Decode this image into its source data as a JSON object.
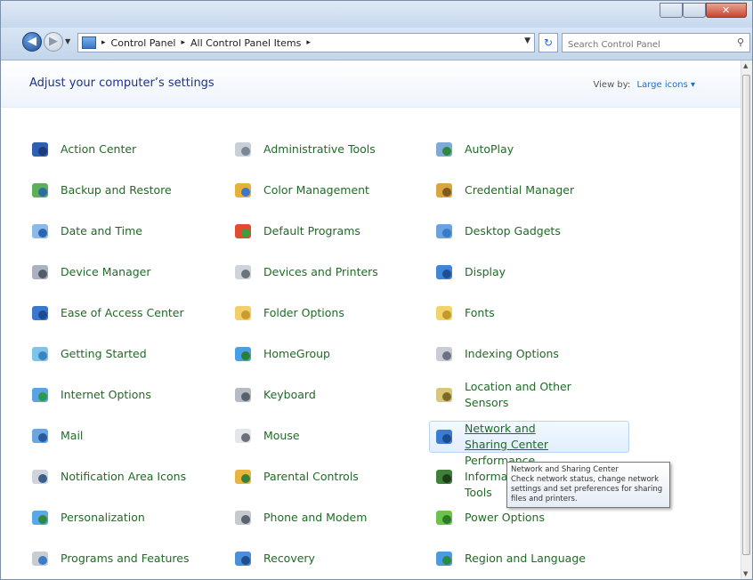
{
  "address": {
    "crumbs": [
      "Control Panel",
      "All Control Panel Items"
    ],
    "separator": "▸",
    "search_placeholder": "Search Control Panel"
  },
  "header": {
    "title": "Adjust your computer’s settings",
    "view_by_label": "View by:",
    "view_by_value": "Large icons ▾"
  },
  "items": [
    {
      "label": "Action Center",
      "icon": "flag-icon"
    },
    {
      "label": "Administrative Tools",
      "icon": "admin-tools-icon"
    },
    {
      "label": "AutoPlay",
      "icon": "autoplay-icon"
    },
    {
      "label": "Backup and Restore",
      "icon": "backup-icon"
    },
    {
      "label": "Color Management",
      "icon": "color-management-icon"
    },
    {
      "label": "Credential Manager",
      "icon": "credential-icon"
    },
    {
      "label": "Date and Time",
      "icon": "calendar-icon"
    },
    {
      "label": "Default Programs",
      "icon": "default-programs-icon"
    },
    {
      "label": "Desktop Gadgets",
      "icon": "gadgets-icon"
    },
    {
      "label": "Device Manager",
      "icon": "device-manager-icon"
    },
    {
      "label": "Devices and Printers",
      "icon": "printer-icon"
    },
    {
      "label": "Display",
      "icon": "display-icon"
    },
    {
      "label": "Ease of Access Center",
      "icon": "accessibility-icon"
    },
    {
      "label": "Folder Options",
      "icon": "folder-icon"
    },
    {
      "label": "Fonts",
      "icon": "fonts-icon"
    },
    {
      "label": "Getting Started",
      "icon": "getting-started-icon"
    },
    {
      "label": "HomeGroup",
      "icon": "homegroup-icon"
    },
    {
      "label": "Indexing Options",
      "icon": "indexing-icon"
    },
    {
      "label": "Internet Options",
      "icon": "globe-icon"
    },
    {
      "label": "Keyboard",
      "icon": "keyboard-icon"
    },
    {
      "label": "Location and Other Sensors",
      "icon": "sensors-icon"
    },
    {
      "label": "Mail",
      "icon": "mail-icon"
    },
    {
      "label": "Mouse",
      "icon": "mouse-icon"
    },
    {
      "label": "Network and Sharing Center",
      "icon": "network-icon"
    },
    {
      "label": "Notification Area Icons",
      "icon": "notification-icon"
    },
    {
      "label": "Parental Controls",
      "icon": "parental-controls-icon"
    },
    {
      "label": "Performance Information and Tools",
      "icon": "performance-icon"
    },
    {
      "label": "Personalization",
      "icon": "personalization-icon"
    },
    {
      "label": "Phone and Modem",
      "icon": "phone-icon"
    },
    {
      "label": "Power Options",
      "icon": "power-icon"
    },
    {
      "label": "Programs and Features",
      "icon": "programs-icon"
    },
    {
      "label": "Recovery",
      "icon": "recovery-icon"
    },
    {
      "label": "Region and Language",
      "icon": "region-icon"
    }
  ],
  "tooltip": {
    "title": "Network and Sharing Center",
    "description": "Check network status, change network settings and set preferences for sharing files and printers."
  }
}
